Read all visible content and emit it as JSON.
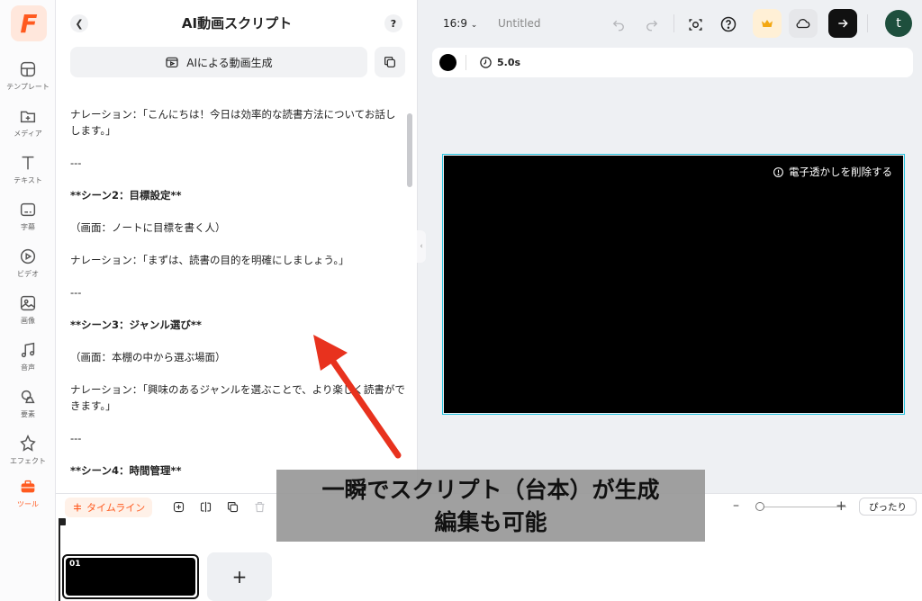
{
  "rail": {
    "items": [
      {
        "label": "テンプレート",
        "icon": "template-icon"
      },
      {
        "label": "メディア",
        "icon": "media-icon"
      },
      {
        "label": "テキスト",
        "icon": "text-icon"
      },
      {
        "label": "字幕",
        "icon": "subtitle-icon"
      },
      {
        "label": "ビデオ",
        "icon": "video-icon"
      },
      {
        "label": "画像",
        "icon": "image-icon"
      },
      {
        "label": "音声",
        "icon": "audio-icon"
      },
      {
        "label": "要素",
        "icon": "elements-icon"
      },
      {
        "label": "エフェクト",
        "icon": "effects-icon"
      },
      {
        "label": "ツール",
        "icon": "tools-icon"
      }
    ],
    "active_item": "ツール",
    "accent": "#ff5a1f"
  },
  "panel": {
    "title": "AI動画スクリプト",
    "help": "?",
    "generate_label": "AIによる動画生成",
    "script": [
      "ナレーション：「こんにちは！今日は効率的な読書方法についてお話しします。」",
      "---",
      "**シーン2：目標設定**",
      "（画面：ノートに目標を書く人）",
      "ナレーション：「まずは、読書の目的を明確にしましょう。」",
      "---",
      "**シーン3：ジャンル選び**",
      "（画面：本棚の中から選ぶ場面）",
      "ナレーション：「興味のあるジャンルを選ぶことで、より楽しく読書ができます。」",
      "---",
      "**シーン4：時間管理**"
    ]
  },
  "topbar": {
    "aspect_ratio": "16:9",
    "document_title": "Untitled",
    "avatar_letter": "t"
  },
  "properties": {
    "duration": "5.0s",
    "color": "#000000"
  },
  "canvas": {
    "watermark_label": "電子透かしを削除する",
    "background": "#000000",
    "border": "#27c4e0"
  },
  "timeline": {
    "tab_label": "タイムライン",
    "fit_label": "ぴったり",
    "clip_number": "01",
    "add_label": "+"
  },
  "caption": {
    "line1": "一瞬でスクリプト（台本）が生成",
    "line2": "編集も可能"
  }
}
